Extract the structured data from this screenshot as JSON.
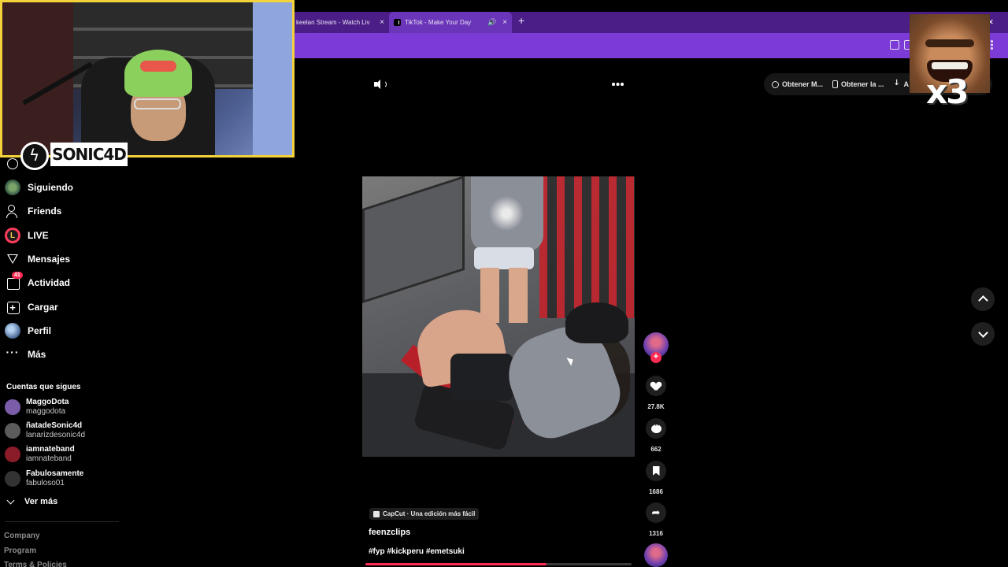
{
  "browser": {
    "tabs": [
      {
        "label": "keelan Stream - Watch Liv"
      },
      {
        "label": "TikTok - Make Your Day"
      }
    ],
    "new_tab": "+",
    "close": "×"
  },
  "webcam": {
    "channel_name": "SONIC4D"
  },
  "sidebar": {
    "nav": [
      {
        "label": "Siguiendo"
      },
      {
        "label": "Friends"
      },
      {
        "label": "LIVE",
        "icon_letter": "L"
      },
      {
        "label": "Mensajes"
      },
      {
        "label": "Actividad",
        "badge": "41"
      },
      {
        "label": "Cargar"
      },
      {
        "label": "Perfil"
      },
      {
        "label": "Más",
        "icon_glyph": "···"
      }
    ],
    "following_title": "Cuentas que sigues",
    "following": [
      {
        "name": "MaggoDota",
        "handle": "maggodota",
        "color": "#7b5ca8"
      },
      {
        "name": "ñatadeSonic4d",
        "handle": "lanarizdesonic4d",
        "color": "#5b5b5b"
      },
      {
        "name": "iamnateband",
        "handle": "iamnateband",
        "color": "#8a1c2a"
      },
      {
        "name": "Fabulosamente",
        "handle": "fabuloso01",
        "color": "#333333"
      }
    ],
    "see_more": "Ver más",
    "footer": [
      "Company",
      "Program",
      "Terms & Policies"
    ]
  },
  "toolbar": {
    "get_buttons": [
      {
        "label": "Obtener M...",
        "icon": "globe-icon"
      },
      {
        "label": "Obtener la ...",
        "icon": "phone-icon"
      },
      {
        "label": "A",
        "icon": "download-icon"
      }
    ]
  },
  "overlay": {
    "meme_text": "x3"
  },
  "video": {
    "likes": "27.8K",
    "comments": "662",
    "saves": "1686",
    "shares": "1316",
    "follow_plus": "+",
    "capcut_label": "CapCut · Una edición más fácil",
    "author": "feenzclips",
    "hashtags": "#fyp #kickperu #emetsuki",
    "progress": 0.68
  },
  "colors": {
    "accent": "#fe2c55",
    "browser_purple": "#7c3ad6",
    "webcam_border": "#f3d23a"
  }
}
